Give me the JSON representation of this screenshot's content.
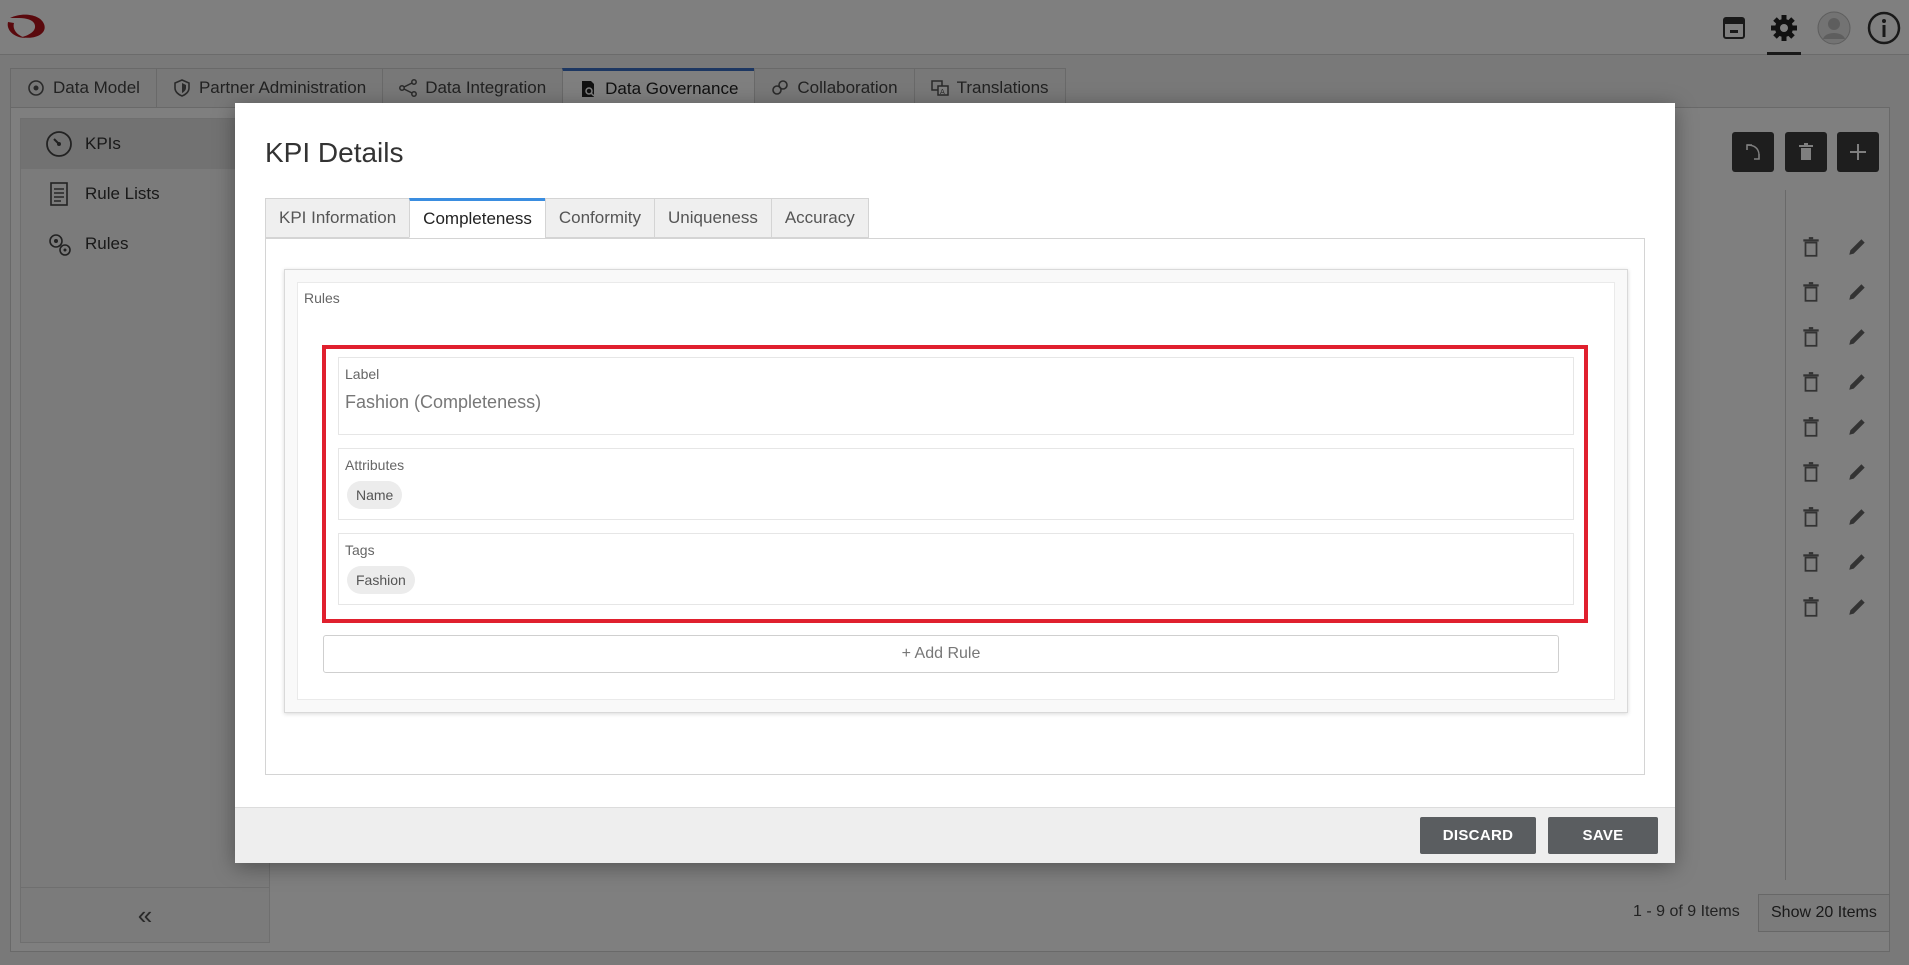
{
  "topbar": {
    "icons": [
      "package-icon",
      "gear-icon",
      "user-avatar-icon",
      "info-icon"
    ]
  },
  "main_tabs": [
    {
      "label": "Data Model",
      "icon": "data-model-icon"
    },
    {
      "label": "Partner Administration",
      "icon": "shield-icon"
    },
    {
      "label": "Data Integration",
      "icon": "integration-icon"
    },
    {
      "label": "Data Governance",
      "icon": "governance-icon",
      "active": true
    },
    {
      "label": "Collaboration",
      "icon": "collaboration-icon"
    },
    {
      "label": "Translations",
      "icon": "translations-icon"
    }
  ],
  "sidebar": {
    "items": [
      {
        "label": "KPIs",
        "icon": "gauge-icon",
        "active": true
      },
      {
        "label": "Rule Lists",
        "icon": "list-icon"
      },
      {
        "label": "Rules",
        "icon": "rules-gear-icon"
      }
    ],
    "collapse_label": "«"
  },
  "grid": {
    "pager_text": "1 - 9 of 9 Items",
    "page_size_label": "Show 20 Items"
  },
  "modal": {
    "title": "KPI Details",
    "tabs": [
      {
        "label": "KPI Information"
      },
      {
        "label": "Completeness",
        "active": true
      },
      {
        "label": "Conformity"
      },
      {
        "label": "Uniqueness"
      },
      {
        "label": "Accuracy"
      }
    ],
    "rules_section_label": "Rules",
    "rule": {
      "label_field_label": "Label",
      "label_value": "Fashion (Completeness)",
      "attributes_label": "Attributes",
      "attributes": [
        "Name"
      ],
      "tags_label": "Tags",
      "tags": [
        "Fashion"
      ]
    },
    "add_rule_label": "+ Add Rule",
    "discard_label": "DISCARD",
    "save_label": "SAVE"
  },
  "colors": {
    "accent_tab": "#3a6fc4",
    "highlight": "#e0202e",
    "button_dark": "#5a5d60"
  }
}
